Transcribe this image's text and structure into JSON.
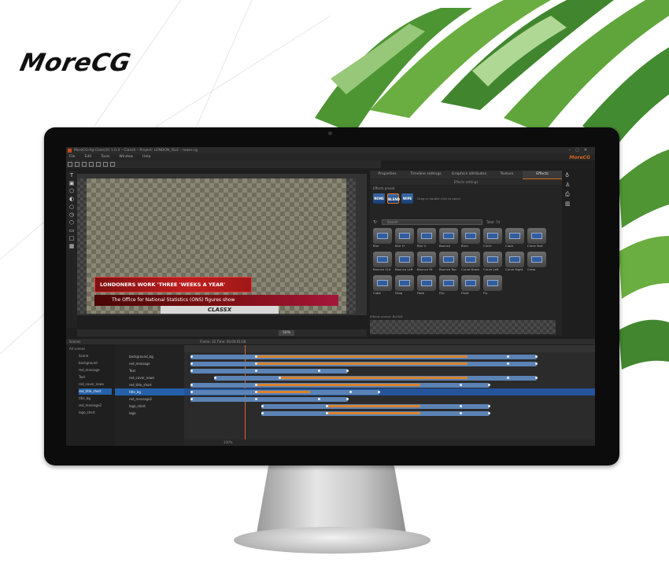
{
  "brand_logo": "MoreCG",
  "colors": {
    "accent": "#d4691c",
    "select_blue": "#2560a8",
    "lower_red": "#c01d1d"
  },
  "window": {
    "title": "MoreCG-Ag-Class(X) 1.0.3 – ClassX – Project: LONDON_ISLE – lower.cg",
    "menu": [
      "File",
      "Edit",
      "Tools",
      "Window",
      "Help"
    ],
    "brand": "MoreCG"
  },
  "preview": {
    "headline": "LONDONERS WORK 'THREE 'WEEKS A YEAR'",
    "subline": "The Office for National Statistics (ONS) figures show",
    "ticker": "CLASSX",
    "zoom": "50%"
  },
  "right_panel": {
    "tabs": [
      "Properties",
      "Timeline settings",
      "Graphics attributes",
      "Texture",
      "Effects"
    ],
    "active_tab": "Effects",
    "subheader": "Effects settings",
    "section_label": "Effects preset",
    "preset_buttons": [
      "NONE",
      "BLEND",
      "WIPE"
    ],
    "hint": "Drag or double click to apply",
    "search_placeholder": "Search",
    "count": "Total: 74",
    "effects": [
      "Blur",
      "Blur H",
      "Blur V",
      "Bounce",
      "Burn",
      "Circle",
      "Clock",
      "Circle Text",
      "Bounce Out",
      "Bounce Left",
      "Bounce Rt",
      "Bounce Top",
      "Curve Down",
      "Curve Left",
      "Curve Right",
      "Cross",
      "Cube",
      "Drop",
      "Fade",
      "Flip",
      "Float",
      "Fly"
    ],
    "footer": "Effects preset: BLEND"
  },
  "timeline": {
    "header": "Scenes",
    "scene_title": "All scenes",
    "scenes": [
      "Scene",
      "background",
      "red_message",
      "Text",
      "red_cover_news",
      "red_title_short",
      "title_bg",
      "red_message2",
      "logo_short"
    ],
    "selected_scene": 5,
    "layers": [
      "background_bg",
      "red_message",
      "Text",
      "red_cover_news",
      "red_title_short",
      "title_bg",
      "red_message2",
      "logo_short",
      "logo"
    ],
    "selected_layer": 5,
    "status": "Frame: 32 Time: 00:00:01:08",
    "footer_zoom": "100%"
  }
}
